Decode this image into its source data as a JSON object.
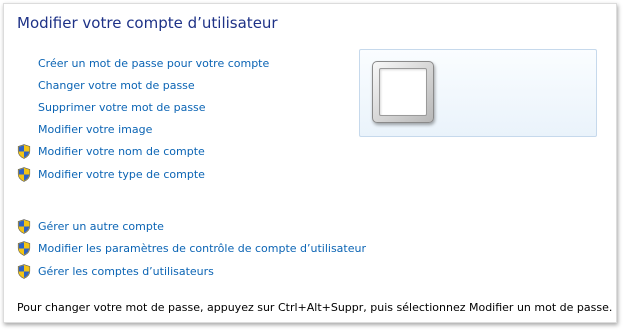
{
  "title": "Modifier votre compte d’utilisateur",
  "account_links": [
    {
      "label": "Créer un mot de passe pour votre compte",
      "icon": "none"
    },
    {
      "label": "Changer votre mot de passe",
      "icon": "none"
    },
    {
      "label": "Supprimer votre mot de passe",
      "icon": "none"
    },
    {
      "label": "Modifier votre image",
      "icon": "none"
    },
    {
      "label": "Modifier votre nom de compte",
      "icon": "uac-shield-icon"
    },
    {
      "label": "Modifier votre type de compte",
      "icon": "uac-shield-icon"
    }
  ],
  "other_links": [
    {
      "label": "Gérer un autre compte",
      "icon": "uac-shield-icon"
    },
    {
      "label": "Modifier les paramètres de contrôle de compte d’utilisateur",
      "icon": "uac-shield-icon"
    },
    {
      "label": "Gérer les comptes d’utilisateurs",
      "icon": "uac-shield-icon"
    }
  ],
  "footer": "Pour changer votre mot de passe, appuyez sur Ctrl+Alt+Suppr, puis sélectionnez Modifier un mot de passe.",
  "colors": {
    "title": "#1e3287",
    "link": "#0b64b4",
    "shield_blue": "#2d62c6",
    "shield_yellow": "#f2c416"
  }
}
